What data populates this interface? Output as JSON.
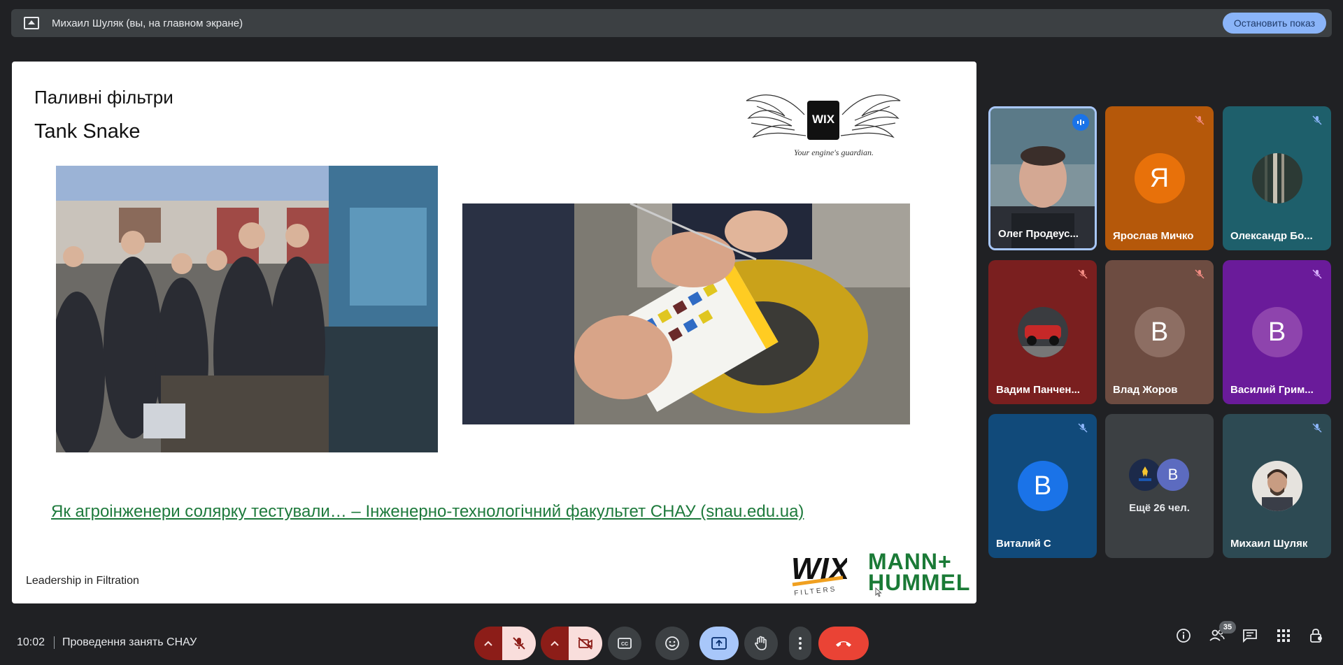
{
  "topbar": {
    "presenter_text": "Михаил Шуляк (вы, на главном экране)",
    "stop_label": "Остановить показ"
  },
  "slide": {
    "title": "Паливні фільтри",
    "subtitle": "Tank Snake",
    "wings_tagline": "Your engine's guardian.",
    "wix_badge": "WIX",
    "link_text": "Як агроінженери солярку тестували… – Інженерно-технологічний факультет СНАУ (snau.edu.ua)",
    "footer": "Leadership in Filtration",
    "logo_wix": "WIX",
    "logo_wix_sub": "FILTERS",
    "logo_mann_line1": "MANN+",
    "logo_mann_line2": "HUMMEL"
  },
  "participants": [
    {
      "name": "Олег Продеус...",
      "speaking": true
    },
    {
      "name": "Ярослав Мичко",
      "initial": "Я",
      "avatar_color": "#e8710a",
      "bg": "#b5580a"
    },
    {
      "name": "Олександр Бо...",
      "bg": "#1e5f6b"
    },
    {
      "name": "Вадим Панчен...",
      "bg": "#7a1f1f"
    },
    {
      "name": "Влад Жоров",
      "initial": "В",
      "avatar_color": "#8d6e63",
      "bg": "#6d4c41"
    },
    {
      "name": "Василий Грим...",
      "initial": "В",
      "avatar_color": "#8e44ad",
      "bg": "#6a1b9a"
    },
    {
      "name": "Виталий С",
      "initial": "В",
      "avatar_color": "#1a73e8",
      "bg": "#114a7a"
    },
    {
      "name": "Ещё 26 чел.",
      "initial": "В",
      "avatar_color": "#5c6bc0",
      "bg": "#3c4043"
    },
    {
      "name": "Михаил Шуляк",
      "bg": "#2d4a53"
    }
  ],
  "bottom": {
    "time": "10:02",
    "meeting_title": "Проведення занять СНАУ",
    "people_count": "35"
  },
  "colors": {
    "danger": "#ea4335",
    "mute_bg": "#f9dedc",
    "present_active": "#a8c7fa",
    "link": "#1e7a3c"
  }
}
